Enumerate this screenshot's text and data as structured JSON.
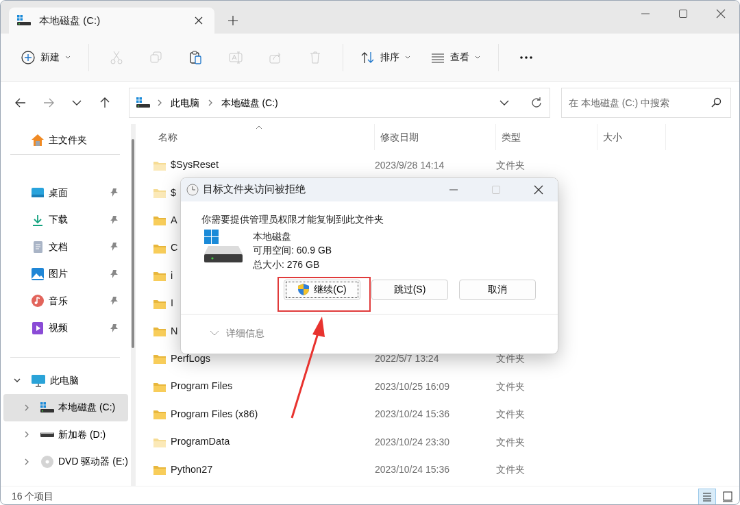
{
  "tab": {
    "title": "本地磁盘 (C:)"
  },
  "toolbar": {
    "items": [
      {
        "kind": "new",
        "label": "新建",
        "disabled": false
      },
      {
        "kind": "cut",
        "disabled": true
      },
      {
        "kind": "copy",
        "disabled": true
      },
      {
        "kind": "paste",
        "disabled": false
      },
      {
        "kind": "rename",
        "disabled": true
      },
      {
        "kind": "share",
        "disabled": true
      },
      {
        "kind": "delete",
        "disabled": true
      },
      {
        "kind": "sort",
        "label": "排序",
        "disabled": false
      },
      {
        "kind": "view",
        "label": "查看",
        "disabled": false
      },
      {
        "kind": "more",
        "disabled": false
      }
    ]
  },
  "address": {
    "breadcrumbs": [
      "此电脑",
      "本地磁盘 (C:)"
    ]
  },
  "search": {
    "placeholder": "在 本地磁盘 (C:) 中搜索"
  },
  "sidebar": {
    "home": {
      "label": "主文件夹"
    },
    "quick_access": [
      {
        "label": "桌面",
        "kind": "desktop",
        "pinned": true
      },
      {
        "label": "下载",
        "kind": "download",
        "pinned": true
      },
      {
        "label": "文档",
        "kind": "document",
        "pinned": true
      },
      {
        "label": "图片",
        "kind": "picture",
        "pinned": true
      },
      {
        "label": "音乐",
        "kind": "music",
        "pinned": true
      },
      {
        "label": "视频",
        "kind": "video",
        "pinned": true
      }
    ],
    "tree": [
      {
        "label": "此电脑",
        "kind": "pc",
        "expanded": true,
        "selected": false,
        "children": [
          {
            "label": "本地磁盘 (C:)",
            "kind": "system-drive",
            "expanded": false,
            "selected": true
          },
          {
            "label": "新加卷 (D:)",
            "kind": "drive",
            "expanded": false,
            "selected": false
          },
          {
            "label": "DVD 驱动器 (E:)",
            "kind": "dvd",
            "expanded": false,
            "selected": false
          }
        ]
      }
    ]
  },
  "table": {
    "columns": [
      "名称",
      "修改日期",
      "类型",
      "大小"
    ],
    "rows": [
      {
        "name": "$SysReset",
        "modified": "2023/9/28 14:14",
        "type": "文件夹",
        "hidden": true
      },
      {
        "name": "$",
        "hidden": true
      },
      {
        "name": "A",
        "hidden": false
      },
      {
        "name": "C",
        "hidden": false
      },
      {
        "name": "i",
        "hidden": false
      },
      {
        "name": "I",
        "hidden": false
      },
      {
        "name": "N",
        "hidden": false
      },
      {
        "name": "PerfLogs",
        "modified": "2022/5/7 13:24",
        "type": "文件夹",
        "hidden": false
      },
      {
        "name": "Program Files",
        "modified": "2023/10/25 16:09",
        "type": "文件夹",
        "hidden": false
      },
      {
        "name": "Program Files (x86)",
        "modified": "2023/10/24 15:36",
        "type": "文件夹",
        "hidden": false
      },
      {
        "name": "ProgramData",
        "modified": "2023/10/24 23:30",
        "type": "文件夹",
        "hidden": true
      },
      {
        "name": "Python27",
        "modified": "2023/10/24 15:36",
        "type": "文件夹",
        "hidden": false
      }
    ]
  },
  "status_bar": {
    "count": "16 个项目",
    "views": [
      {
        "kind": "details",
        "selected": true
      },
      {
        "kind": "tiles",
        "selected": false
      }
    ]
  },
  "dialog": {
    "title": "目标文件夹访问被拒绝",
    "message": "你需要提供管理员权限才能复制到此文件夹",
    "drive_name": "本地磁盘",
    "free_space": "可用空间: 60.9 GB",
    "total_size": "总大小: 276 GB",
    "buttons": [
      {
        "label": "继续(C)",
        "kind": "shield",
        "focused": true
      },
      {
        "label": "跳过(S)",
        "kind": "plain",
        "focused": false
      },
      {
        "label": "取消",
        "kind": "plain",
        "focused": false
      }
    ],
    "details": {
      "label": "详细信息",
      "expanded": false
    }
  }
}
